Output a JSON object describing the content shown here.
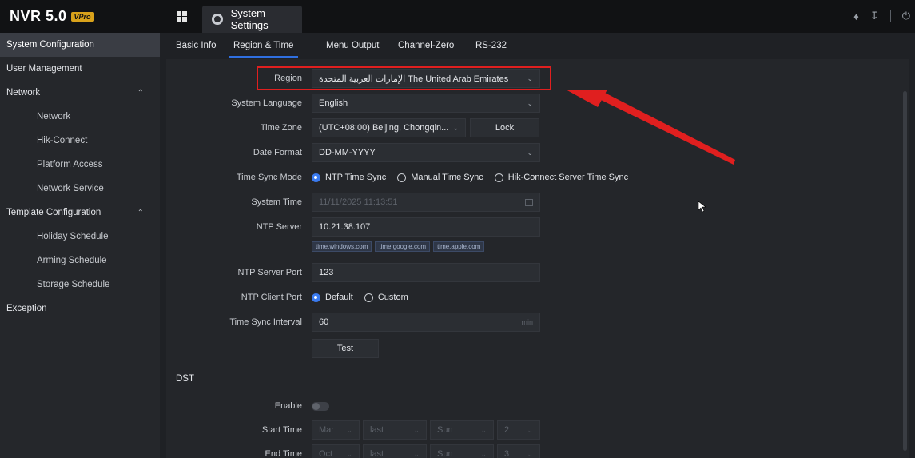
{
  "header": {
    "logo_text": "NVR 5.0",
    "logo_badge": "VPro",
    "apps_icon": "apps-grid-icon",
    "tab_title": "System Settings",
    "tab_icon": "gear-icon",
    "top_icons": [
      "bell-icon",
      "download-icon",
      "power-icon"
    ]
  },
  "sidebar": {
    "items": [
      {
        "label": "System Configuration"
      },
      {
        "label": "User Management"
      },
      {
        "label": "Network"
      },
      {
        "label": "Network"
      },
      {
        "label": "Hik-Connect"
      },
      {
        "label": "Platform Access"
      },
      {
        "label": "Network Service"
      },
      {
        "label": "Template Configuration"
      },
      {
        "label": "Holiday Schedule"
      },
      {
        "label": "Arming Schedule"
      },
      {
        "label": "Storage Schedule"
      },
      {
        "label": "Exception"
      }
    ]
  },
  "tabs": [
    {
      "label": "Basic Info"
    },
    {
      "label": "Region & Time"
    },
    {
      "label": "Menu Output"
    },
    {
      "label": "Channel-Zero"
    },
    {
      "label": "RS-232"
    }
  ],
  "form": {
    "region": {
      "label": "Region",
      "value": "الإمارات العربية المتحدة The United Arab Emirates"
    },
    "language": {
      "label": "System Language",
      "value": "English"
    },
    "timezone": {
      "label": "Time Zone",
      "value": "(UTC+08:00) Beijing, Chongqin...",
      "lock": "Lock"
    },
    "date_format": {
      "label": "Date Format",
      "value": "DD-MM-YYYY"
    },
    "sync_mode": {
      "label": "Time Sync Mode",
      "options": [
        "NTP Time Sync",
        "Manual Time Sync",
        "Hik-Connect Server Time Sync"
      ],
      "selected": "NTP Time Sync"
    },
    "system_time": {
      "label": "System Time",
      "value": "11/11/2025 11:13:51"
    },
    "ntp_server": {
      "label": "NTP Server",
      "value": "10.21.38.107",
      "suggestions": [
        "time.windows.com",
        "time.google.com",
        "time.apple.com"
      ]
    },
    "ntp_port": {
      "label": "NTP Server Port",
      "value": "123"
    },
    "client_port": {
      "label": "NTP Client Port",
      "options": [
        "Default",
        "Custom"
      ],
      "selected": "Default"
    },
    "sync_interval": {
      "label": "Time Sync Interval",
      "value": "60",
      "unit": "min"
    },
    "test": "Test"
  },
  "dst": {
    "title": "DST",
    "enable": {
      "label": "Enable",
      "on": false
    },
    "start": {
      "label": "Start Time",
      "month": "Mar",
      "week": "last",
      "day": "Sun",
      "hour": "2"
    },
    "end": {
      "label": "End Time",
      "month": "Oct",
      "week": "last",
      "day": "Sun",
      "hour": "3"
    }
  },
  "colors": {
    "accent": "#2f6fe0",
    "highlight": "#e01f1f",
    "arrow": "#e01f1f"
  }
}
